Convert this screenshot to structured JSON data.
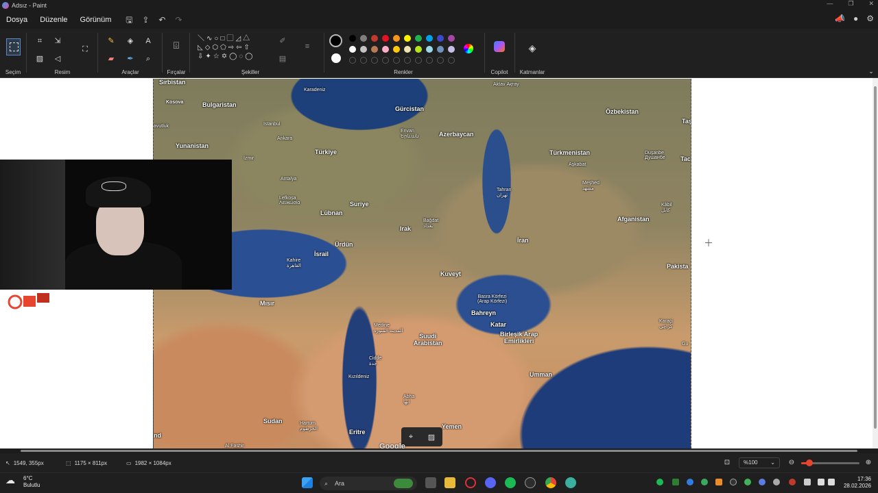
{
  "window": {
    "title": "Adsız - Paint"
  },
  "menu": {
    "items": [
      "Dosya",
      "Düzenle",
      "Görünüm"
    ]
  },
  "ribbon": {
    "groups": {
      "selection": "Seçim",
      "image": "Resim",
      "tools": "Araçlar",
      "brushes": "Fırçalar",
      "shapes": "Şekiller",
      "colors": "Renkler",
      "copilot": "Copilot",
      "layers": "Katmanlar"
    },
    "palette_row1": [
      "#000000",
      "#7f7f7f",
      "#c0392b",
      "#e81123",
      "#f7941d",
      "#fff200",
      "#22b14c",
      "#00a2e8",
      "#3f48cc",
      "#a349a4"
    ],
    "palette_row2": [
      "#ffffff",
      "#c3c3c3",
      "#b97a57",
      "#ffaec9",
      "#ffc90e",
      "#efe4b0",
      "#b5e61d",
      "#99d9ea",
      "#7092be",
      "#c8bfe7"
    ],
    "primary_color": "#000000",
    "secondary_color": "#ffffff"
  },
  "map": {
    "labels": {
      "sirbistan": "Sırbistan",
      "karadeniz": "Karadeniz",
      "gurcistan": "Gürcistan",
      "aktav": "Aktav\nАқтау",
      "ozbekistan": "Özbekistan",
      "taskent": "Taş",
      "kosova": "Kosova",
      "bulgaristan": "Bulgaristan",
      "istanbul": "İstanbul",
      "erivan": "Erivan\nԵրևան",
      "azerbaycan": "Azerbaycan",
      "turkmenistan": "Türkmenistan",
      "dusanbe": "Duşanbe\nДушанбе",
      "tac": "Tac",
      "avutluk": "avutluk",
      "yunanistan": "Yunanistan",
      "ankara": "Ankara",
      "turkiye": "Türkiye",
      "askabat": "Aşkabat",
      "izmir": "İzmir",
      "meshed": "Meşhed\nمشهد",
      "antalya": "Antalya",
      "tahran": "Tahran\nتهران",
      "kabil": "Kâbil\nکابل",
      "lefkosa": "Lefkoşa\nΛευκωσία",
      "suriye": "Suriye",
      "lubnan": "Lübnan",
      "bagdat": "Bağdat\nبغداد",
      "afganistan": "Afganistan",
      "irak": "Irak",
      "iran": "İran",
      "urdun": "Ürdün",
      "israil": "İsrail",
      "kahire": "Kahire\nالقاهرة",
      "kuveyt": "Kuveyt",
      "pakistan": "Pakista",
      "basra": "Basra Körfezi\n(Arap Körfezi)",
      "misir": "Mısır",
      "bahreyn": "Bahreyn",
      "medine": "Medine\nالمدينة المنورة",
      "katar": "Katar",
      "karaci": "Karaçi\nکراچی",
      "suudi": "Suudi\nArabistan",
      "bae": "Birleşik Arap\nEmirlikleri",
      "gu": "Gu",
      "cidde": "Cidde\nجدة",
      "kizildeniz": "Kızıldeniz",
      "umman": "Umman",
      "abha": "Abha\nأبها",
      "sudan": "Sudan",
      "hartum": "Hartum\nالخرطوم",
      "yemen": "Yemen",
      "eritre": "Eritre",
      "alfasir": "Al Fashir",
      "nd": "nd"
    },
    "attribution": "Google"
  },
  "status": {
    "cursor_pos": "1549, 355px",
    "selection_size": "1175 × 811px",
    "canvas_size": "1982 × 1084px",
    "zoom": "%100",
    "zoom_fraction": 0.14
  },
  "taskbar": {
    "search_placeholder": "Ara",
    "weather_temp": "6°C",
    "weather_desc": "Bulutlu",
    "time": "17:36",
    "date": "28.02.2026"
  }
}
